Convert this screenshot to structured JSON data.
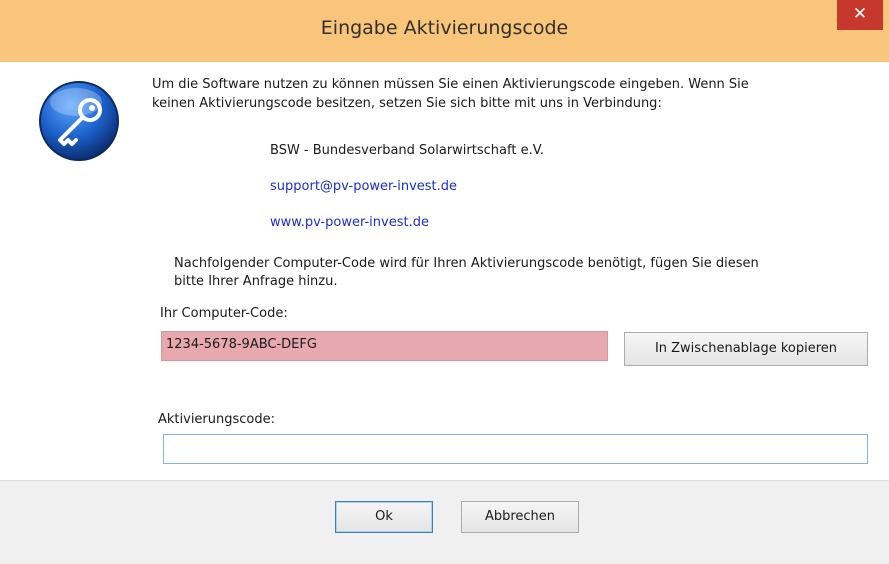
{
  "window": {
    "title": "Eingabe Aktivierungscode",
    "close_glyph": "✕"
  },
  "icon": {
    "name": "key-icon",
    "color": "#1a5fb4"
  },
  "intro": {
    "line1": "Um die Software nutzen zu können müssen Sie einen Aktivierungscode eingeben. Wenn Sie",
    "line2": "keinen Aktivierungscode besitzen, setzen Sie sich bitte mit uns in Verbindung:"
  },
  "contact": {
    "organization": "BSW - Bundesverband Solarwirtschaft e.V.",
    "email": "support@pv-power-invest.de",
    "website": "www.pv-power-invest.de"
  },
  "notice": {
    "line1": "Nachfolgender Computer-Code wird für Ihren Aktivierungscode benötigt, fügen Sie diesen",
    "line2": "bitte Ihrer Anfrage hinzu."
  },
  "computer_code": {
    "label": "Ihr Computer-Code:",
    "value": "1234-5678-9ABC-DEFG",
    "copy_button": "In Zwischenablage kopieren",
    "field_color": "#e8a8b0"
  },
  "activation": {
    "label": "Aktivierungscode:",
    "value": ""
  },
  "buttons": {
    "ok": "Ok",
    "cancel": "Abbrechen"
  }
}
